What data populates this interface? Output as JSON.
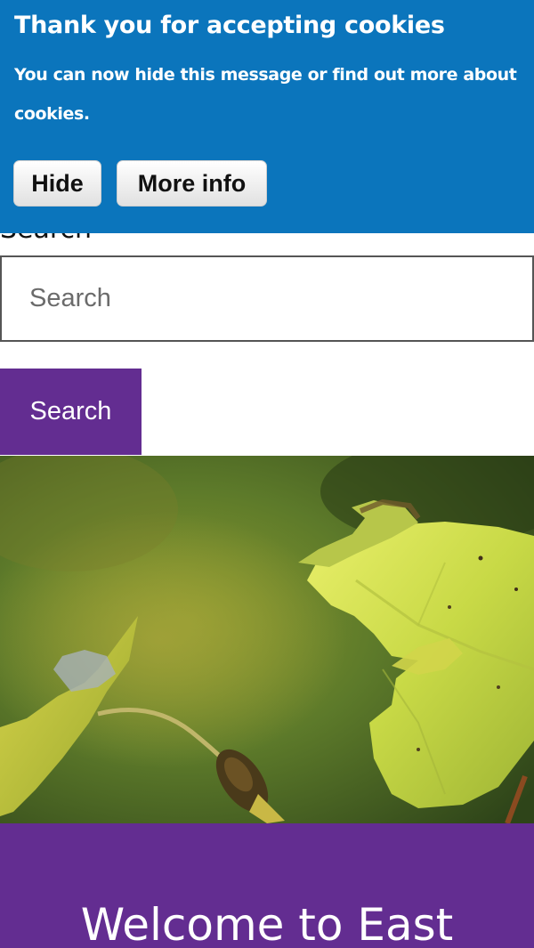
{
  "cookie_banner": {
    "title": "Thank you for accepting cookies",
    "message": "You can now hide this message or find out more about cookies.",
    "hide_label": "Hide",
    "more_info_label": "More info",
    "background_color": "#0b75bc"
  },
  "search": {
    "label": "Search",
    "placeholder": "Search",
    "button_label": "Search",
    "button_color": "#632d91"
  },
  "hero": {
    "image": "autumn-leaves-photo"
  },
  "welcome": {
    "title": "Welcome to East",
    "background_color": "#632d91"
  }
}
